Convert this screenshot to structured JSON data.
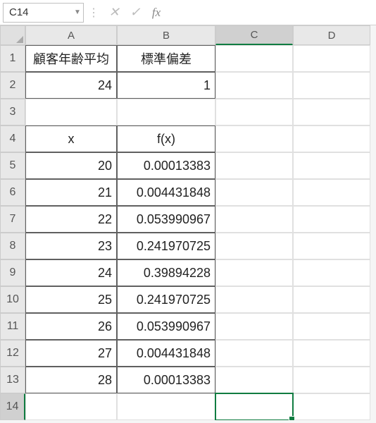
{
  "formula_bar": {
    "name_box": "C14",
    "cancel_label": "✕",
    "enter_label": "✓",
    "fx_label": "fx",
    "formula_value": ""
  },
  "columns": [
    "A",
    "B",
    "C",
    "D"
  ],
  "active_col_index": 2,
  "rows": [
    {
      "n": 1,
      "A": "顧客年齢平均",
      "B": "標準偏差",
      "A_align": "center",
      "B_align": "center",
      "A_border": true,
      "B_border": true
    },
    {
      "n": 2,
      "A": "24",
      "B": "1",
      "A_align": "right",
      "B_align": "right",
      "A_border": true,
      "B_border": true
    },
    {
      "n": 3,
      "A": "",
      "B": "",
      "A_align": "left",
      "B_align": "left",
      "A_border": false,
      "B_border": false
    },
    {
      "n": 4,
      "A": "x",
      "B": "f(x)",
      "A_align": "center",
      "B_align": "center",
      "A_border": true,
      "B_border": true
    },
    {
      "n": 5,
      "A": "20",
      "B": "0.00013383",
      "A_align": "right",
      "B_align": "right",
      "A_border": true,
      "B_border": true
    },
    {
      "n": 6,
      "A": "21",
      "B": "0.004431848",
      "A_align": "right",
      "B_align": "right",
      "A_border": true,
      "B_border": true
    },
    {
      "n": 7,
      "A": "22",
      "B": "0.053990967",
      "A_align": "right",
      "B_align": "right",
      "A_border": true,
      "B_border": true
    },
    {
      "n": 8,
      "A": "23",
      "B": "0.241970725",
      "A_align": "right",
      "B_align": "right",
      "A_border": true,
      "B_border": true
    },
    {
      "n": 9,
      "A": "24",
      "B": "0.39894228",
      "A_align": "right",
      "B_align": "right",
      "A_border": true,
      "B_border": true
    },
    {
      "n": 10,
      "A": "25",
      "B": "0.241970725",
      "A_align": "right",
      "B_align": "right",
      "A_border": true,
      "B_border": true
    },
    {
      "n": 11,
      "A": "26",
      "B": "0.053990967",
      "A_align": "right",
      "B_align": "right",
      "A_border": true,
      "B_border": true
    },
    {
      "n": 12,
      "A": "27",
      "B": "0.004431848",
      "A_align": "right",
      "B_align": "right",
      "A_border": true,
      "B_border": true
    },
    {
      "n": 13,
      "A": "28",
      "B": "0.00013383",
      "A_align": "right",
      "B_align": "right",
      "A_border": true,
      "B_border": true
    },
    {
      "n": 14,
      "A": "",
      "B": "",
      "A_align": "left",
      "B_align": "left",
      "A_border": false,
      "B_border": false
    }
  ],
  "active_cell": "C14",
  "chart_data": {
    "type": "table",
    "parameters": {
      "mean_label": "顧客年齢平均",
      "mean": 24,
      "stddev_label": "標準偏差",
      "stddev": 1
    },
    "title": "",
    "columns": [
      "x",
      "f(x)"
    ],
    "x": [
      20,
      21,
      22,
      23,
      24,
      25,
      26,
      27,
      28
    ],
    "fx": [
      0.00013383,
      0.004431848,
      0.053990967,
      0.241970725,
      0.39894228,
      0.241970725,
      0.053990967,
      0.004431848,
      0.00013383
    ]
  }
}
